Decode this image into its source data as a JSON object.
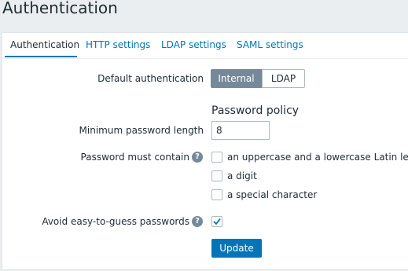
{
  "page": {
    "title": "Authentication"
  },
  "tabs": [
    {
      "label": "Authentication",
      "active": true
    },
    {
      "label": "HTTP settings",
      "active": false
    },
    {
      "label": "LDAP settings",
      "active": false
    },
    {
      "label": "SAML settings",
      "active": false
    }
  ],
  "form": {
    "default_auth": {
      "label": "Default authentication",
      "options": [
        "Internal",
        "LDAP"
      ],
      "selected": "Internal"
    },
    "password_policy": {
      "title": "Password policy",
      "min_length": {
        "label": "Minimum password length",
        "value": "8"
      },
      "must_contain": {
        "label": "Password must contain",
        "help_icon": "question-mark-icon",
        "options": [
          {
            "label": "an uppercase and a lowercase Latin letter",
            "checked": false
          },
          {
            "label": "a digit",
            "checked": false
          },
          {
            "label": "a special character",
            "checked": false
          }
        ]
      },
      "avoid_easy": {
        "label": "Avoid easy-to-guess passwords",
        "help_icon": "question-mark-icon",
        "checked": true
      }
    },
    "submit": {
      "label": "Update"
    }
  },
  "colors": {
    "accent": "#0275b8",
    "selected_segment": "#76899a",
    "background": "#ebeef0"
  }
}
